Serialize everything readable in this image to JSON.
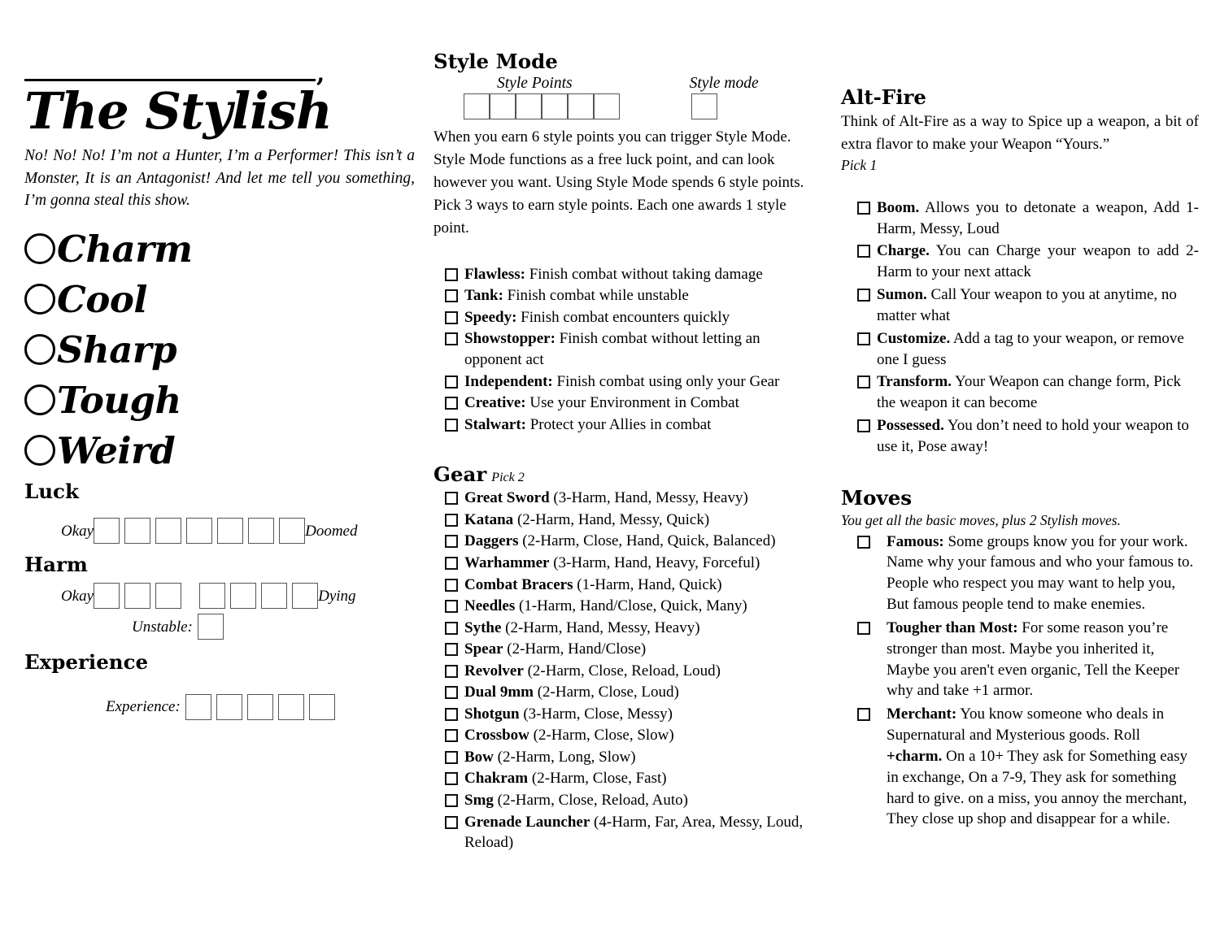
{
  "left": {
    "name_field": {
      "value": "",
      "trailing_punctuation": ","
    },
    "title": "The Stylish",
    "blurb": "No! No! No! I’m not a Hunter, I’m a Performer! This isn’t a Monster, It is an Antagonist! And let me tell you something, I’m gonna steal this show.",
    "ratings": [
      {
        "label": "Charm",
        "value": ""
      },
      {
        "label": "Cool",
        "value": ""
      },
      {
        "label": "Sharp",
        "value": ""
      },
      {
        "label": "Tough",
        "value": ""
      },
      {
        "label": "Weird",
        "value": ""
      }
    ],
    "luck": {
      "heading": "Luck",
      "start_label": "Okay",
      "end_label": "Doomed",
      "boxes": 7
    },
    "harm": {
      "heading": "Harm",
      "start_label": "Okay",
      "end_label": "Dying",
      "boxes_group_1": 3,
      "boxes_group_2": 4,
      "unstable_label": "Unstable:",
      "unstable_boxes": 1
    },
    "experience": {
      "heading": "Experience",
      "label": "Experience:",
      "boxes": 5
    }
  },
  "middle": {
    "style_mode": {
      "heading": "Style Mode",
      "points_caption": "Style Points",
      "mode_caption": "Style mode",
      "points_boxes": 6,
      "mode_boxes": 1,
      "description": "When you earn 6 style points you can trigger Style Mode. Style Mode functions as a free luck point, and can look however you want. Using Style Mode spends 6 style points. Pick 3 ways to earn style points. Each one awards 1 style point.",
      "options": [
        {
          "name": "Flawless:",
          "desc": " Finish combat without taking damage"
        },
        {
          "name": "Tank:",
          "desc": " Finish combat while unstable"
        },
        {
          "name": "Speedy:",
          "desc": " Finish combat encounters quickly"
        },
        {
          "name": "Showstopper:",
          "desc": " Finish combat without letting an opponent act"
        },
        {
          "name": "Independent:",
          "desc": " Finish combat using only your Gear"
        },
        {
          "name": "Creative:",
          "desc": " Use your Environment in Combat"
        },
        {
          "name": "Stalwart:",
          "desc": " Protect your Allies in combat"
        }
      ]
    },
    "gear": {
      "heading": "Gear",
      "pick": "Pick 2",
      "items": [
        {
          "name": "Great Sword",
          "desc": " (3-Harm, Hand, Messy, Heavy)"
        },
        {
          "name": "Katana",
          "desc": " (2-Harm, Hand, Messy, Quick)"
        },
        {
          "name": "Daggers",
          "desc": " (2-Harm, Close, Hand, Quick, Balanced)"
        },
        {
          "name": "Warhammer",
          "desc": " (3-Harm, Hand, Heavy, Forceful)"
        },
        {
          "name": "Combat Bracers",
          "desc": " (1-Harm, Hand, Quick)"
        },
        {
          "name": "Needles",
          "desc": " (1-Harm, Hand/Close, Quick, Many)"
        },
        {
          "name": "Sythe",
          "desc": " (2-Harm, Hand, Messy, Heavy)"
        },
        {
          "name": "Spear",
          "desc": " (2-Harm, Hand/Close)"
        },
        {
          "name": "Revolver",
          "desc": " (2-Harm, Close, Reload, Loud)"
        },
        {
          "name": "Dual 9mm",
          "desc": " (2-Harm, Close, Loud)"
        },
        {
          "name": "Shotgun",
          "desc": " (3-Harm, Close, Messy)"
        },
        {
          "name": "Crossbow",
          "desc": " (2-Harm, Close, Slow)"
        },
        {
          "name": "Bow",
          "desc": " (2-Harm, Long, Slow)"
        },
        {
          "name": "Chakram",
          "desc": " (2-Harm, Close, Fast)"
        },
        {
          "name": "Smg",
          "desc": " (2-Harm, Close, Reload, Auto)"
        },
        {
          "name": "Grenade Launcher",
          "desc": " (4-Harm, Far, Area, Messy, Loud, Reload)"
        }
      ]
    }
  },
  "right": {
    "alt_fire": {
      "heading": "Alt-Fire",
      "description": "Think of Alt-Fire as a way to Spice up a weapon, a bit of extra flavor to make your Weapon “Yours.”",
      "pick": "Pick 1",
      "options": [
        {
          "name": "Boom.",
          "desc": " Allows you to detonate a weapon, Add 1-Harm, Messy, Loud"
        },
        {
          "name": "Charge.",
          "desc": "  You can Charge your weapon to add 2-Harm to your next attack"
        },
        {
          "name": "Sumon.",
          "desc": " Call  Your weapon to you at anytime, no matter what"
        },
        {
          "name": "Customize.",
          "desc": " Add a tag to your weapon, or remove one I guess"
        },
        {
          "name": "Transform.",
          "desc": " Your Weapon can change form, Pick the weapon it can become"
        },
        {
          "name": "Possessed.",
          "desc": " You don’t need to hold your weapon to use it, Pose away!"
        }
      ]
    },
    "moves": {
      "heading": "Moves",
      "intro": "You get all the basic moves, plus 2 Stylish moves.",
      "options": [
        {
          "name": "Famous:",
          "desc": " Some groups know you for your work. Name why your famous and who your famous to. People who respect you may want to help you, But famous people tend to make enemies."
        },
        {
          "name": "Tougher than Most:",
          "desc": " For some reason you’re stronger than most. Maybe you inherited it, Maybe you aren't even organic, Tell the Keeper why and take +1 armor."
        },
        {
          "name": "Merchant:",
          "desc_1": " You know someone who deals in Supernatural and Mysterious goods. Roll ",
          "bold_2": "+charm.",
          "desc_3": " On a 10+ They ask for Something easy in exchange, On a 7-9, They ask for something hard to give. on a miss, you annoy the merchant, They close up shop and disappear for a while."
        }
      ]
    }
  }
}
